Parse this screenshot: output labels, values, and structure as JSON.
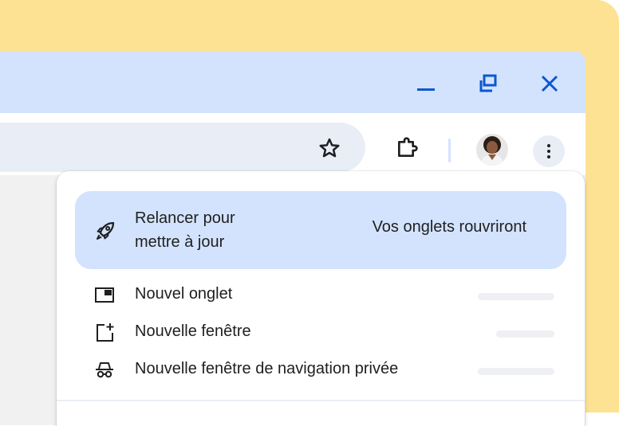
{
  "window_controls": {
    "minimize_icon": "minimize-icon",
    "restore_icon": "restore-icon",
    "close_icon": "close-icon"
  },
  "toolbar": {
    "bookmark_icon": "star-icon",
    "extensions_icon": "puzzle-icon",
    "menu_icon": "more-vert-icon"
  },
  "menu": {
    "relaunch": {
      "label": "Relancer pour mettre à jour",
      "subtext": "Vos onglets rouvriront",
      "icon": "rocket-icon"
    },
    "items": [
      {
        "label": "Nouvel onglet",
        "icon": "new-tab-icon"
      },
      {
        "label": "Nouvelle fenêtre",
        "icon": "new-window-icon"
      },
      {
        "label": "Nouvelle fenêtre de navigation privée",
        "icon": "incognito-icon"
      }
    ]
  },
  "colors": {
    "accent": "#0b57d0",
    "chrome_bg": "#d3e3fd",
    "background_card": "#fde293",
    "omnibox": "#e9eef6"
  }
}
